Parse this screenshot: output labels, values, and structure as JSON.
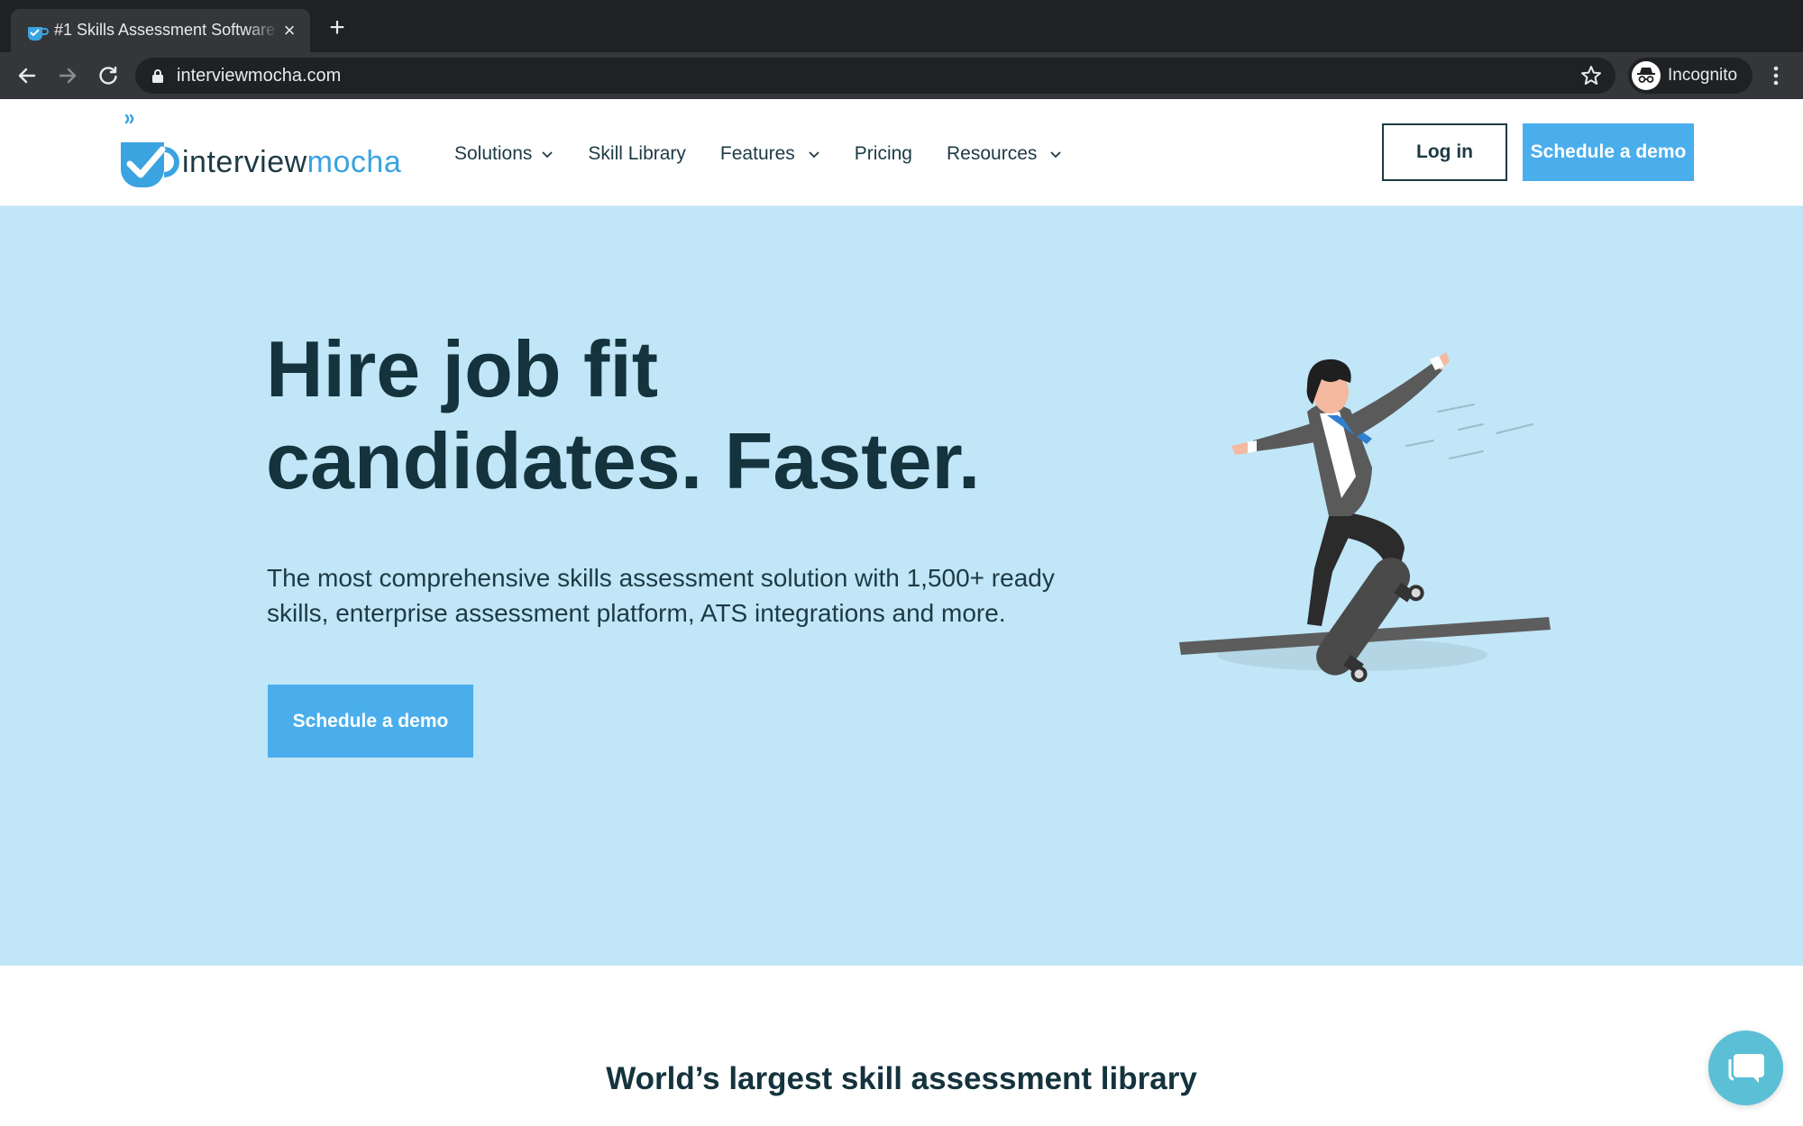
{
  "browser": {
    "tab_title": "#1 Skills Assessment Software",
    "tab_close": "×",
    "new_tab": "+",
    "url": "interviewmocha.com",
    "profile_label": "Incognito"
  },
  "site": {
    "logo_text_primary": "interview",
    "logo_text_accent": "mocha",
    "nav": [
      {
        "label": "Solutions",
        "has_dropdown": true
      },
      {
        "label": "Skill Library",
        "has_dropdown": false
      },
      {
        "label": "Features",
        "has_dropdown": true
      },
      {
        "label": "Pricing",
        "has_dropdown": false
      },
      {
        "label": "Resources",
        "has_dropdown": true
      }
    ],
    "login_label": "Log in",
    "demo_label": "Schedule a demo"
  },
  "hero": {
    "title_line1": "Hire job fit",
    "title_line2": "candidates. Faster.",
    "subtitle": "The most comprehensive skills assessment solution with 1,500+ ready skills, enterprise assessment platform, ATS integrations and more.",
    "cta_label": "Schedule a demo"
  },
  "section": {
    "title": "World’s largest skill assessment library"
  },
  "colors": {
    "brand_blue": "#4aaeec",
    "hero_bg": "#c0e6f8",
    "text_dark": "#14333d"
  },
  "icons": [
    "back-icon",
    "forward-icon",
    "reload-icon",
    "lock-icon",
    "star-icon",
    "incognito-icon",
    "kebab-menu-icon",
    "chevron-down-icon",
    "chat-icon"
  ]
}
